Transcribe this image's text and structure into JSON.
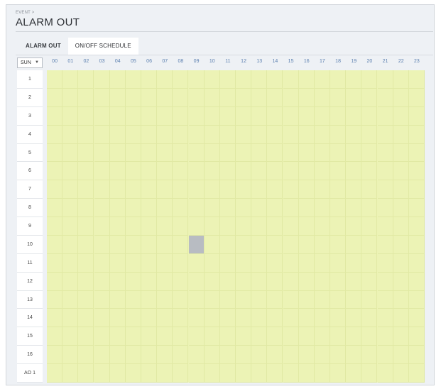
{
  "header": {
    "breadcrumb": "EVENT >",
    "title": "ALARM OUT"
  },
  "tabs": [
    {
      "label": "ALARM OUT",
      "active": false
    },
    {
      "label": "ON/OFF SCHEDULE",
      "active": true
    }
  ],
  "day_select": {
    "value": "SUN"
  },
  "hours": [
    "00",
    "01",
    "02",
    "03",
    "04",
    "05",
    "06",
    "07",
    "08",
    "09",
    "10",
    "11",
    "12",
    "13",
    "14",
    "15",
    "16",
    "17",
    "18",
    "19",
    "20",
    "21",
    "22",
    "23"
  ],
  "rows": [
    "1",
    "2",
    "3",
    "4",
    "5",
    "6",
    "7",
    "8",
    "9",
    "10",
    "11",
    "12",
    "13",
    "14",
    "15",
    "16",
    "AO 1"
  ],
  "selected_cells": [
    {
      "row": "10",
      "hour": "09"
    }
  ],
  "colors": {
    "cell_off": "#ecf3b5",
    "cell_on": "#b8bcc2",
    "hour_label": "#5b7fb0"
  }
}
